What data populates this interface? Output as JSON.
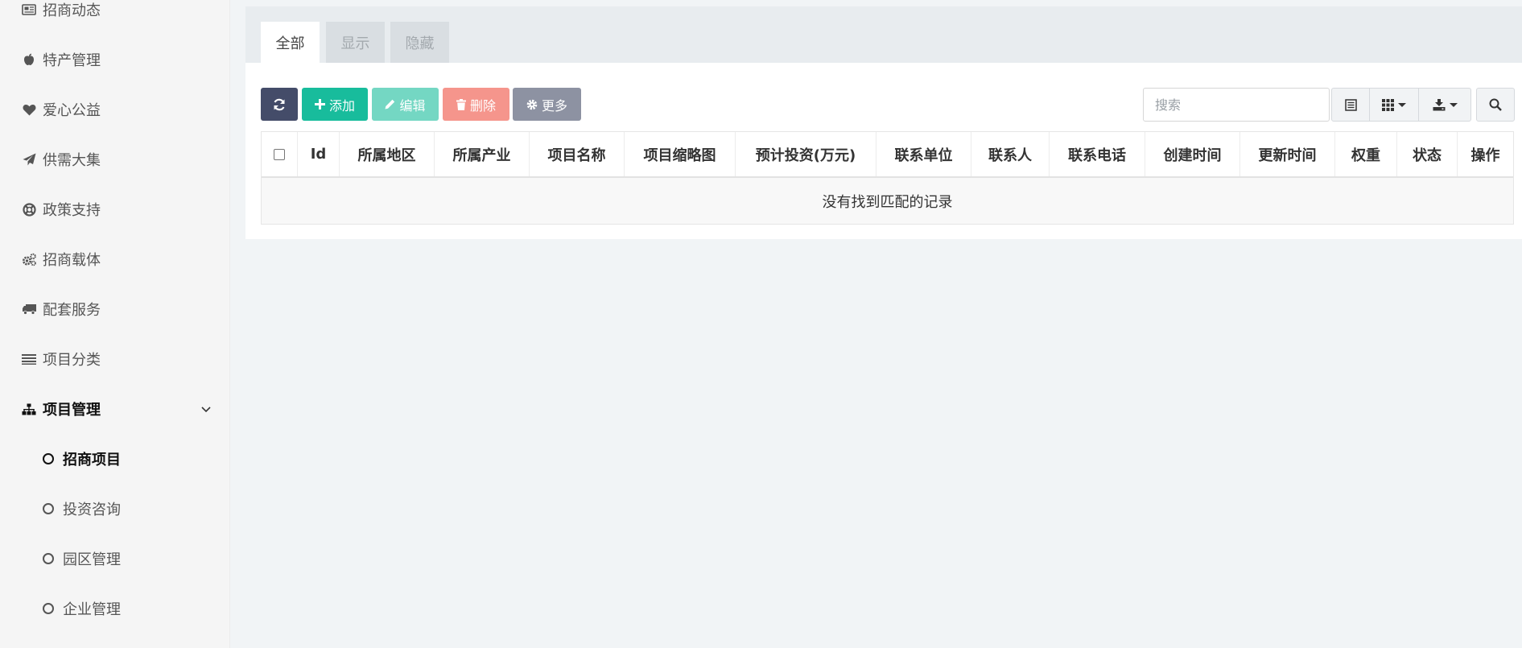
{
  "sidebar": {
    "items": [
      {
        "label": "招商动态",
        "icon": "newspaper-icon"
      },
      {
        "label": "特产管理",
        "icon": "apple-icon"
      },
      {
        "label": "爱心公益",
        "icon": "heart-icon"
      },
      {
        "label": "供需大集",
        "icon": "paper-plane-icon"
      },
      {
        "label": "政策支持",
        "icon": "life-ring-icon"
      },
      {
        "label": "招商载体",
        "icon": "gears-icon"
      },
      {
        "label": "配套服务",
        "icon": "truck-icon"
      },
      {
        "label": "项目分类",
        "icon": "list-icon"
      },
      {
        "label": "项目管理",
        "icon": "sitemap-icon",
        "expanded": true
      }
    ],
    "sub_items": [
      {
        "label": "招商项目",
        "active": true
      },
      {
        "label": "投资咨询"
      },
      {
        "label": "园区管理"
      },
      {
        "label": "企业管理"
      }
    ]
  },
  "tabs": [
    {
      "label": "全部",
      "active": true
    },
    {
      "label": "显示"
    },
    {
      "label": "隐藏"
    }
  ],
  "toolbar": {
    "add_label": "添加",
    "edit_label": "编辑",
    "delete_label": "删除",
    "more_label": "更多",
    "search_placeholder": "搜索"
  },
  "table": {
    "columns": [
      "Id",
      "所属地区",
      "所属产业",
      "项目名称",
      "项目缩略图",
      "预计投资(万元)",
      "联系单位",
      "联系人",
      "联系电话",
      "创建时间",
      "更新时间",
      "权重",
      "状态",
      "操作"
    ],
    "empty_text": "没有找到匹配的记录"
  },
  "colors": {
    "refresh": "#444c69",
    "add": "#18bc9c",
    "edit": "#74d7c3",
    "delete": "#f5958c",
    "more": "#8d92a2"
  }
}
